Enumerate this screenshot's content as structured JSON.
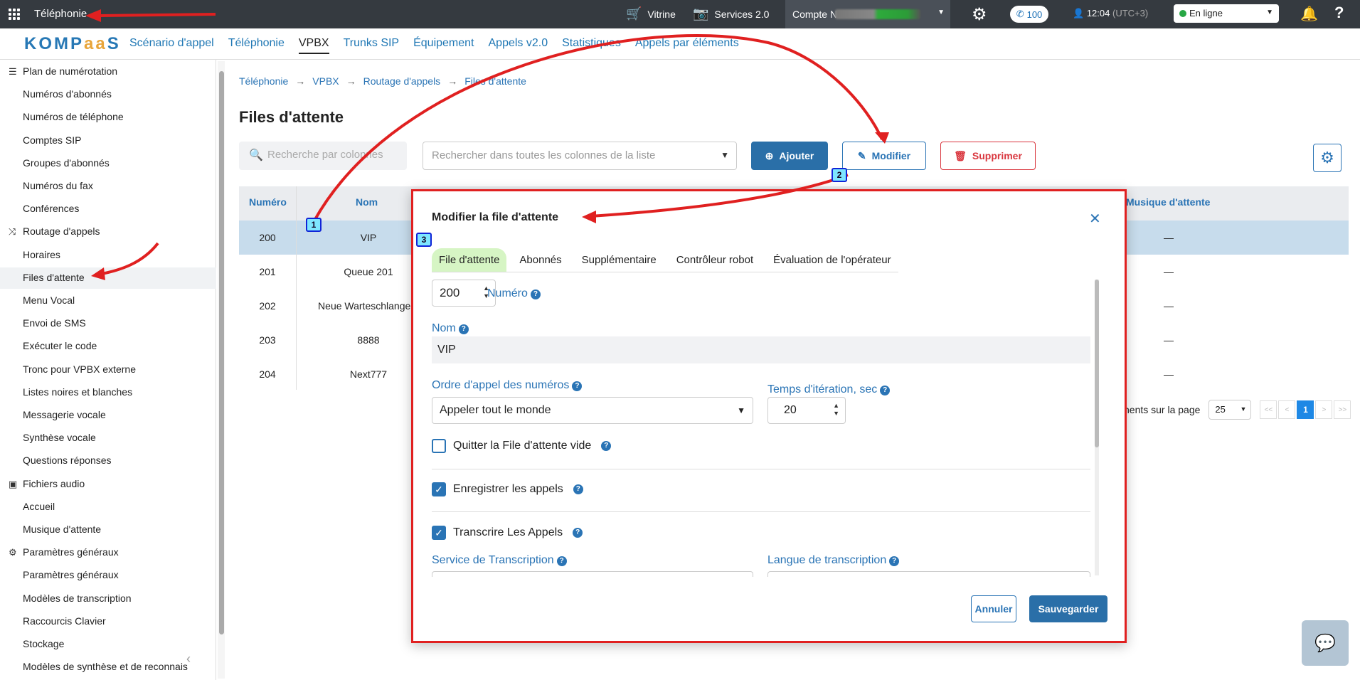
{
  "topbar": {
    "app_title": "Téléphonie",
    "vitrine": "Vitrine",
    "services": "Services 2.0",
    "account_label": "Compte №",
    "calls_count": "100",
    "time": "12:04",
    "timezone": "(UTC+3)",
    "status": "En ligne"
  },
  "navbar": {
    "logo": "KOMPaaS",
    "items": [
      "Scénario d'appel",
      "Téléphonie",
      "VPBX",
      "Trunks SIP",
      "Équipement",
      "Appels v2.0",
      "Statistiques",
      "Appels par éléments"
    ],
    "active": "VPBX"
  },
  "sidebar": {
    "items": [
      {
        "label": "Plan de numérotation",
        "group": true,
        "icon": "list-icon"
      },
      {
        "label": "Numéros d'abonnés"
      },
      {
        "label": "Numéros de téléphone"
      },
      {
        "label": "Comptes SIP"
      },
      {
        "label": "Groupes d'abonnés"
      },
      {
        "label": "Numéros du fax"
      },
      {
        "label": "Conférences"
      },
      {
        "label": "Routage d'appels",
        "group": true,
        "icon": "routing-icon"
      },
      {
        "label": "Horaires"
      },
      {
        "label": "Files d'attente",
        "active": true
      },
      {
        "label": "Menu Vocal"
      },
      {
        "label": "Envoi de SMS"
      },
      {
        "label": "Exécuter le code"
      },
      {
        "label": "Tronc pour VPBX externe"
      },
      {
        "label": "Listes noires et blanches"
      },
      {
        "label": "Messagerie vocale"
      },
      {
        "label": "Synthèse vocale"
      },
      {
        "label": "Questions réponses"
      },
      {
        "label": "Fichiers audio",
        "group": true,
        "icon": "audio-files-icon"
      },
      {
        "label": "Accueil"
      },
      {
        "label": "Musique d'attente"
      },
      {
        "label": "Paramètres généraux",
        "group": true,
        "icon": "gear-icon"
      },
      {
        "label": "Paramètres généraux"
      },
      {
        "label": "Modèles de transcription"
      },
      {
        "label": "Raccourcis Clavier"
      },
      {
        "label": "Stockage"
      },
      {
        "label": "Modèles de synthèse et de reconnais"
      }
    ]
  },
  "breadcrumb": [
    "Téléphonie",
    "VPBX",
    "Routage d'appels",
    "Files d'attente"
  ],
  "page_title": "Files d'attente",
  "toolbar": {
    "search_cols_placeholder": "Recherche par colonnes",
    "search_all_placeholder": "Rechercher dans toutes les colonnes de la liste",
    "add": "Ajouter",
    "edit": "Modifier",
    "delete": "Supprimer"
  },
  "table": {
    "headers": {
      "numero": "Numéro",
      "nom": "Nom",
      "musique": "Musique d'attente"
    },
    "rows": [
      {
        "numero": "200",
        "nom": "VIP",
        "musique": "—",
        "selected": true
      },
      {
        "numero": "201",
        "nom": "Queue 201",
        "musique": "—"
      },
      {
        "numero": "202",
        "nom": "Neue Warteschlange –",
        "musique": "—"
      },
      {
        "numero": "203",
        "nom": "8888",
        "musique": "—"
      },
      {
        "numero": "204",
        "nom": "Next777",
        "musique": "—"
      }
    ]
  },
  "pagination": {
    "per_page_label": "nents sur la page",
    "per_page": "25",
    "first": "<<",
    "prev": "<",
    "current": "1",
    "next": ">",
    "last": ">>"
  },
  "modal": {
    "title": "Modifier la file d'attente",
    "tabs": [
      "File d'attente",
      "Abonnés",
      "Supplémentaire",
      "Contrôleur robot",
      "Évaluation de l'opérateur"
    ],
    "active_tab": "File d'attente",
    "numero_value": "200",
    "numero_label": "Numéro",
    "nom_label": "Nom",
    "nom_value": "VIP",
    "ordre_label": "Ordre d'appel des numéros",
    "ordre_value": "Appeler tout le monde",
    "iteration_label": "Temps d'itération, sec",
    "iteration_value": "20",
    "quit_empty_label": "Quitter la File d'attente vide",
    "quit_empty_checked": false,
    "record_label": "Enregistrer les appels",
    "record_checked": true,
    "transcribe_label": "Transcrire Les Appels",
    "transcribe_checked": true,
    "service_label": "Service de Transcription",
    "langue_label": "Langue de transcription",
    "cancel": "Annuler",
    "save": "Sauvegarder"
  },
  "annotations": {
    "step1": "1",
    "step2": "2",
    "step3": "3"
  },
  "colors": {
    "accent": "#2a74b5",
    "danger": "#d9363e",
    "highlight": "#e02020",
    "active_tab": "#d6f5c4",
    "selected_row": "#c7dcec"
  }
}
